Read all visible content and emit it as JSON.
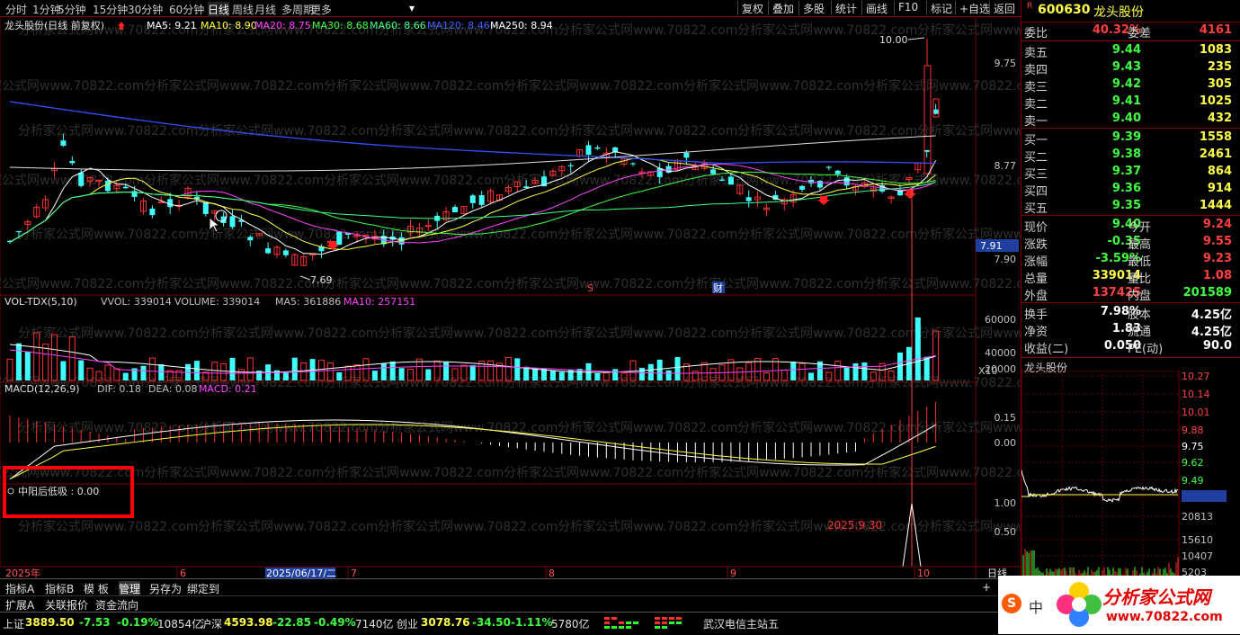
{
  "toolbar": {
    "periods": [
      "分时",
      "1分钟",
      "5分钟",
      "15分钟",
      "30分钟",
      "60分钟",
      "日线",
      "周线",
      "月线",
      "多周期",
      "更多"
    ],
    "active_period": "日线",
    "right_buttons": [
      "复权",
      "叠加",
      "多股",
      "统计",
      "画线",
      "F10",
      "标记",
      "+自选",
      "返回"
    ]
  },
  "main_chart": {
    "title": "龙头股份(日线 前复权)",
    "ma_legend": [
      {
        "label": "MA5: 9.21",
        "color": "#ffffff"
      },
      {
        "label": "MA10: 8.90",
        "color": "#ffff40"
      },
      {
        "label": "MA20: 8.75",
        "color": "#ff40ff"
      },
      {
        "label": "MA30: 8.68",
        "color": "#40ff40"
      },
      {
        "label": "MA60: 8.66",
        "color": "#40ff80"
      },
      {
        "label": "MA120: 8.46",
        "color": "#4060ff"
      },
      {
        "label": "MA250: 8.94",
        "color": "#ffffff"
      }
    ],
    "price_axis": [
      "9.75",
      "8.77",
      "7.90"
    ],
    "high_label": "10.00",
    "low_label": "7.69",
    "current_price_tag": "7.91",
    "marker_s": "S",
    "marker_cai": "财",
    "watermark": "分析家公式网www.70822.com"
  },
  "volume_panel": {
    "title": "VOL-TDX(5,10)",
    "legend": [
      {
        "label": "VVOL: 339014",
        "color": "#c0c0c0"
      },
      {
        "label": "VOLUME: 339014",
        "color": "#c0c0c0"
      },
      {
        "label": "MA5: 361886",
        "color": "#c0c0c0"
      },
      {
        "label": "MA10: 257151",
        "color": "#ff40ff"
      }
    ],
    "axis": [
      "60000",
      "40000",
      "20000"
    ],
    "unit": "X10"
  },
  "macd_panel": {
    "title": "MACD(12,26,9)",
    "legend": [
      {
        "label": "DIF: 0.18",
        "color": "#c0c0c0"
      },
      {
        "label": "DEA: 0.08",
        "color": "#c0c0c0"
      },
      {
        "label": "MACD: 0.21",
        "color": "#ff40ff"
      }
    ],
    "axis": [
      "0.15",
      "0.00"
    ]
  },
  "indicator_panel": {
    "title": "中阳后低吸 : 0.00",
    "axis": [
      "1.00",
      "0.50"
    ],
    "signal_date": "2025.9.30"
  },
  "date_axis": {
    "labels": [
      "2025年",
      "6",
      "2025/06/17/二",
      "7",
      "8",
      "9",
      "10"
    ],
    "period": "日线"
  },
  "bottom_tabs": [
    "指标A",
    "指标B",
    "模 板",
    "管理",
    "另存为",
    "绑定到"
  ],
  "bottom_tabs2": [
    "扩展A",
    "关联报价",
    "资金流向"
  ],
  "status": {
    "sh_label": "上证",
    "sh_val": "3889.50",
    "sh_chg": "-7.53",
    "sh_pct": "-0.19%",
    "sh_amt": "10854亿",
    "sz_label": "沪深",
    "sz_val": "4593.98",
    "sz_chg": "-22.85",
    "sz_pct": "-0.49%",
    "sz_amt": "7140亿",
    "cy_label": "创业",
    "cy_val": "3078.76",
    "cy_chg": "-34.50",
    "cy_pct": "-1.11%",
    "cy_amt": "5780亿",
    "site": "武汉电信主站五"
  },
  "quote": {
    "code": "600630",
    "name": "龙头股份",
    "weibi_label": "委比",
    "weibi": "40.32%",
    "weicha_label": "委差",
    "weicha": "4161",
    "sells": [
      {
        "label": "卖五",
        "price": "9.44",
        "vol": "1083"
      },
      {
        "label": "卖四",
        "price": "9.43",
        "vol": "235"
      },
      {
        "label": "卖三",
        "price": "9.42",
        "vol": "305"
      },
      {
        "label": "卖二",
        "price": "9.41",
        "vol": "1025"
      },
      {
        "label": "卖一",
        "price": "9.40",
        "vol": "432"
      }
    ],
    "buys": [
      {
        "label": "买一",
        "price": "9.39",
        "vol": "1558"
      },
      {
        "label": "买二",
        "price": "9.38",
        "vol": "2461"
      },
      {
        "label": "买三",
        "price": "9.37",
        "vol": "864"
      },
      {
        "label": "买四",
        "price": "9.36",
        "vol": "914"
      },
      {
        "label": "买五",
        "price": "9.35",
        "vol": "1444"
      }
    ],
    "stats": [
      {
        "l1": "现价",
        "v1": "9.40",
        "c1": "green",
        "l2": "今开",
        "v2": "9.24",
        "c2": "red"
      },
      {
        "l1": "涨跌",
        "v1": "-0.35",
        "c1": "green",
        "l2": "最高",
        "v2": "9.55",
        "c2": "red"
      },
      {
        "l1": "涨幅",
        "v1": "-3.59%",
        "c1": "green",
        "l2": "最低",
        "v2": "9.23",
        "c2": "red"
      },
      {
        "l1": "总量",
        "v1": "339014",
        "c1": "yellow",
        "l2": "量比",
        "v2": "1.08",
        "c2": "red"
      },
      {
        "l1": "外盘",
        "v1": "137425",
        "c1": "red",
        "l2": "内盘",
        "v2": "201589",
        "c2": "green"
      }
    ],
    "stats2": [
      {
        "l1": "换手",
        "v1": "7.98%",
        "l2": "股本",
        "v2": "4.25亿"
      },
      {
        "l1": "净资",
        "v1": "1.83",
        "l2": "流通",
        "v2": "4.25亿"
      },
      {
        "l1": "收益(二)",
        "v1": "0.050",
        "l2": "PE(动)",
        "v2": "90.0"
      }
    ],
    "mini_title": "龙头股份",
    "mini_axis": [
      "10.27",
      "10.14",
      "10.01",
      "9.88",
      "9.75",
      "9.62",
      "9.49",
      "9.36",
      "20813",
      "15610",
      "10407",
      "5203"
    ]
  },
  "logo": {
    "text": "分析家公式网",
    "url": "www.70822.com",
    "short": "中"
  }
}
